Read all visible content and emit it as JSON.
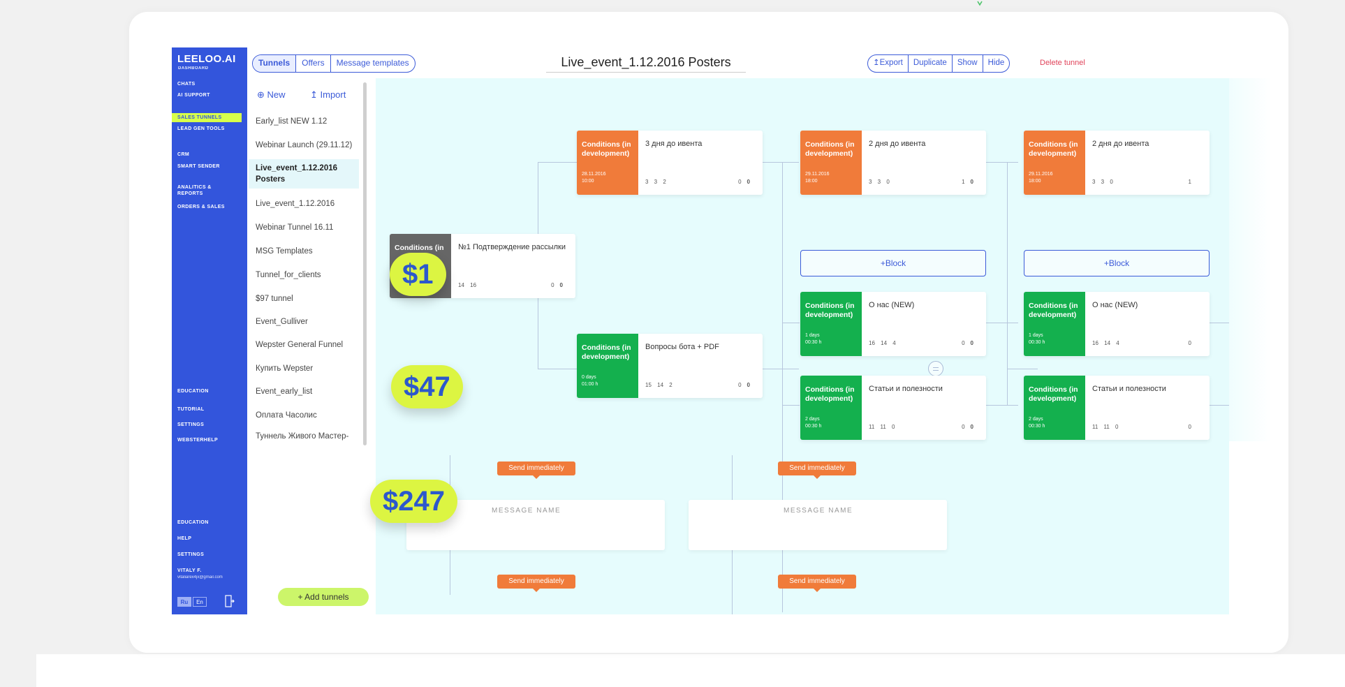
{
  "app": {
    "logo": "LEELOO.AI",
    "logo_sub": "DASHBOARD"
  },
  "nav": {
    "items": [
      "CHATS",
      "AI SUPPORT",
      "SALES TUNNELS",
      "LEAD GEN TOOLS",
      "CRM",
      "SMART SENDER",
      "ANALITICS & REPORTS",
      "ORDERS & SALES",
      "EDUCATION",
      "TUTORIAL",
      "SETTINGS",
      "WEBSTERHELP",
      "EDUCATION",
      "HELP",
      "SETTINGS",
      "VITALY F."
    ],
    "active": "SALES TUNNELS",
    "email": "vitaliarex4jx@gmail.com",
    "lang_ru": "Ru",
    "lang_en": "En"
  },
  "tabs": [
    "Tunnels",
    "Offers",
    "Message templates"
  ],
  "tunnel_title": "Live_event_1.12.2016 Posters",
  "actions": [
    "↥Export",
    "Duplicate",
    "Show",
    "Hide"
  ],
  "delete_label": "Delete tunnel",
  "tunnel_list": {
    "new_label": "⊕ New",
    "import_label": "↥ Import",
    "items": [
      "Early_list NEW 1.12",
      "Webinar Launch (29.11.12)",
      "Live_event_1.12.2016 Posters",
      "Live_event_1.12.2016",
      "Webinar Tunnel 16.11",
      "MSG Templates",
      "Tunnel_for_clients",
      "$97 tunnel",
      "Event_Gulliver",
      "Wepster General Funnel",
      "Купить Wepster",
      "Event_early_list",
      "Оплата Часолис",
      "Туннель Живого Мастер-"
    ],
    "active_index": 2,
    "add_label": "+ Add tunnels"
  },
  "nodes": {
    "root": {
      "cond": "Conditions (in",
      "msg": "№1 Подтверждение рассылки",
      "stats": "14 16",
      "right": "0",
      "right_b": "0"
    },
    "o1": {
      "cond": "Conditions (in development)",
      "meta1": "28.11.2016",
      "meta2": "10:00",
      "msg": "3 дня до ивента",
      "stats": "3 3 2",
      "right": "0",
      "right_b": "0"
    },
    "o2": {
      "cond": "Conditions (in development)",
      "meta1": "29.11.2016",
      "meta2": "18:00",
      "msg": "2 дня до ивента",
      "stats": "3 3 0",
      "right": "1",
      "right_b": "0"
    },
    "o3": {
      "cond": "Conditions (in development)",
      "meta1": "29.11.2016",
      "meta2": "18:00",
      "msg": "2 дня до ивента",
      "stats": "3 3 0",
      "right": "1",
      "right_b": ""
    },
    "g1": {
      "cond": "Conditions (in development)",
      "meta1": "0 days",
      "meta2": "01:00 h",
      "msg": "Вопросы бота + PDF",
      "stats": "15 14 2",
      "right": "0",
      "right_b": "0"
    },
    "g2": {
      "cond": "Conditions (in development)",
      "meta1": "1 days",
      "meta2": "00:30 h",
      "msg": "О нас (NEW)",
      "stats": "16 14 4",
      "right": "0",
      "right_b": "0"
    },
    "g3": {
      "cond": "Conditions (in development)",
      "meta1": "2 days",
      "meta2": "00:30 h",
      "msg": "Статьи и полезности",
      "stats": "11 11 0",
      "right": "0",
      "right_b": "0"
    },
    "g4": {
      "cond": "Conditions (in development)",
      "meta1": "1 days",
      "meta2": "00:30 h",
      "msg": "О нас (NEW)",
      "stats": "16 14 4",
      "right": "0",
      "right_b": ""
    },
    "g5": {
      "cond": "Conditions (in development)",
      "meta1": "2 days",
      "meta2": "00:30 h",
      "msg": "Статьи и полезности",
      "stats": "11 11 0",
      "right": "0",
      "right_b": ""
    }
  },
  "add_block_label": "+Block",
  "send_immediately": "Send immediately",
  "message_name": "MESSAGE NAME",
  "prices": [
    "$1",
    "$47",
    "$247"
  ],
  "colors": {
    "nav": "#3355dc",
    "accent": "#d7ff4a",
    "orange": "#f07b3a",
    "green": "#14b04e",
    "canvas": "#e6fcfd"
  }
}
